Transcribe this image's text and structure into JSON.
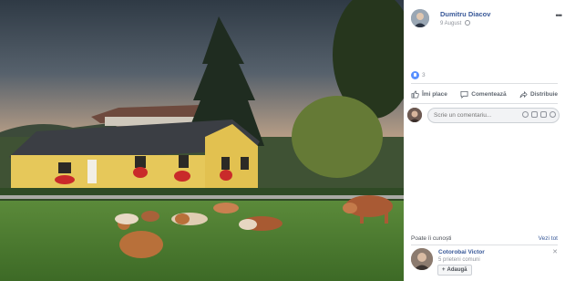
{
  "photo": {
    "description_icon": "photo-viewer-image"
  },
  "post": {
    "author": "Dumitru Diacov",
    "date": "9 August",
    "audience_icon": "globe-icon",
    "more_label": "•••",
    "likes": "3"
  },
  "actions": {
    "like": "Îmi place",
    "comment": "Comentează",
    "share": "Distribuie"
  },
  "comment_box": {
    "placeholder": "Scrie un comentariu..."
  },
  "people_you_may_know": {
    "title": "Poate îi cunoști",
    "see_all": "Vezi tot",
    "person": {
      "name": "Cotorobai Victor",
      "mutual": "5 prieteni comuni",
      "add_label": "Adaugă"
    }
  },
  "colors": {
    "link": "#385898",
    "like_blue": "#5890ff",
    "muted": "#90949c"
  }
}
